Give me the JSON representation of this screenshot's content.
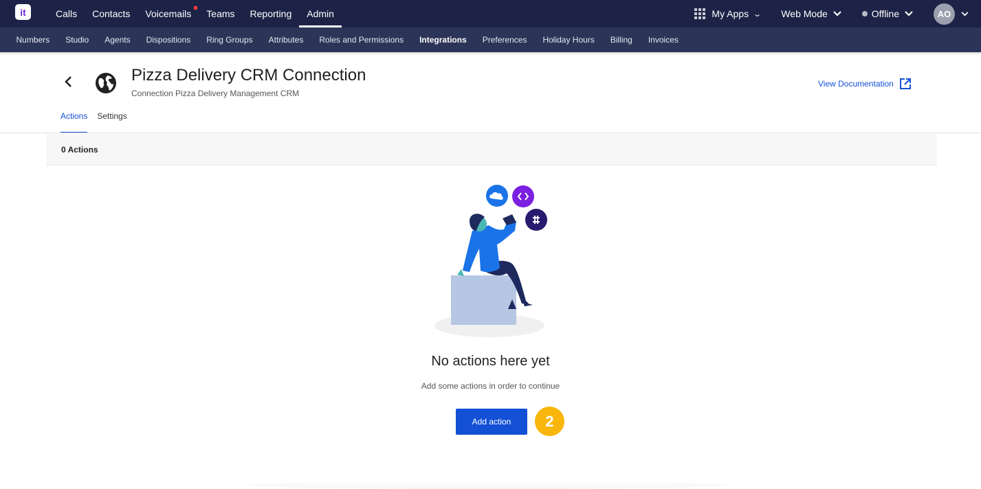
{
  "app": {
    "logo_text": "it"
  },
  "top_nav": {
    "items": [
      {
        "label": "Calls"
      },
      {
        "label": "Contacts"
      },
      {
        "label": "Voicemails"
      },
      {
        "label": "Teams"
      },
      {
        "label": "Reporting"
      },
      {
        "label": "Admin"
      }
    ],
    "my_apps_label": "My Apps",
    "mode_label": "Web Mode",
    "status_label": "Offline",
    "avatar_initials": "AO"
  },
  "sub_nav": {
    "items": [
      {
        "label": "Numbers"
      },
      {
        "label": "Studio"
      },
      {
        "label": "Agents"
      },
      {
        "label": "Dispositions"
      },
      {
        "label": "Ring Groups"
      },
      {
        "label": "Attributes"
      },
      {
        "label": "Roles and Permissions"
      },
      {
        "label": "Integrations"
      },
      {
        "label": "Preferences"
      },
      {
        "label": "Holiday Hours"
      },
      {
        "label": "Billing"
      },
      {
        "label": "Invoices"
      }
    ]
  },
  "header": {
    "title": "Pizza Delivery CRM Connection",
    "subtitle": "Connection Pizza Delivery Management CRM",
    "docs_label": "View Documentation"
  },
  "tabs": [
    {
      "label": "Actions"
    },
    {
      "label": "Settings"
    }
  ],
  "actions_count_label": "0 Actions",
  "empty_state": {
    "title": "No actions here yet",
    "subtitle": "Add some actions in order to continue",
    "button_label": "Add action"
  },
  "step_badge": "2",
  "colors": {
    "topbar": "#1c2346",
    "subbar": "#2c3558",
    "primary": "#1350d6",
    "badge": "#f9b60c"
  }
}
